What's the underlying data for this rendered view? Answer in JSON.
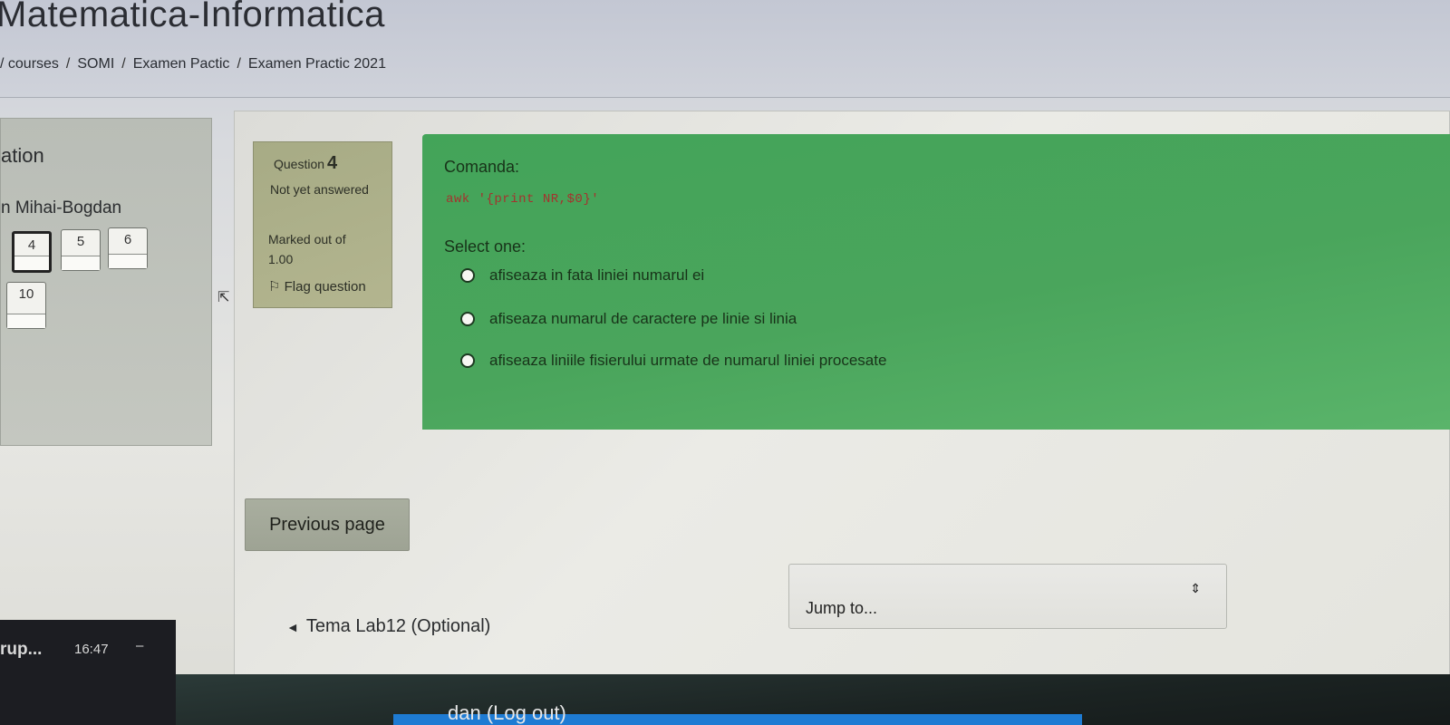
{
  "header": {
    "course_title": "Matematica-Informatica",
    "breadcrumb": [
      "/ courses",
      "SOMI",
      "Examen Pactic",
      "Examen Practic 2021"
    ],
    "separator": "/"
  },
  "quiz_nav": {
    "title": "ation",
    "user": "n Mihai-Bogdan",
    "buttons": [
      {
        "label": "4",
        "current": true
      },
      {
        "label": "5",
        "current": false
      },
      {
        "label": "6",
        "current": false
      },
      {
        "label": "10",
        "current": false
      }
    ]
  },
  "question_info": {
    "question_label": "Question",
    "question_number": "4",
    "state": "Not yet answered",
    "marked_label": "Marked out of",
    "marked_value": "1.00",
    "flag_label": "Flag question",
    "flag_icon": "flag-icon"
  },
  "question": {
    "text": "Comanda:",
    "code": "awk '{print NR,$0}'",
    "prompt": "Select one:",
    "options": [
      "afiseaza in fata liniei numarul ei",
      "afiseaza numarul de caractere pe linie si linia",
      "afiseaza liniile fisierului urmate de numarul liniei procesate"
    ],
    "box_color": "#4aa55c"
  },
  "navigation": {
    "previous_page": "Previous page",
    "jump_to": "Jump to...",
    "prev_activity": "Tema Lab12 (Optional)"
  },
  "taskbar": {
    "task_label": "rup...",
    "time": "16:47",
    "dash": "–"
  },
  "footer": {
    "logout": "dan (Log out)"
  }
}
